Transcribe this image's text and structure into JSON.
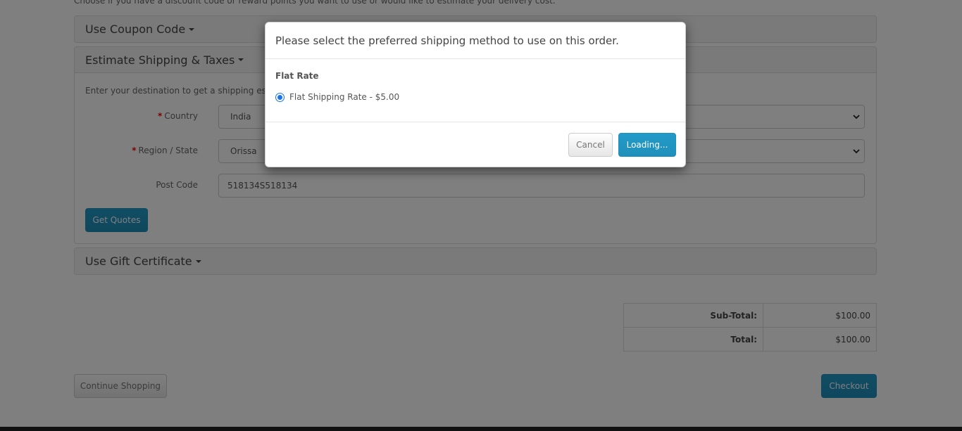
{
  "intro_text": "Choose if you have a discount code or reward points you want to use or would like to estimate your delivery cost.",
  "coupon_panel": {
    "title": "Use Coupon Code"
  },
  "shipping_panel": {
    "title": "Estimate Shipping & Taxes",
    "help_text": "Enter your destination to get a shipping estimate.",
    "country": {
      "label": "Country",
      "required_mark": "*",
      "value": "India"
    },
    "region": {
      "label": "Region / State",
      "required_mark": "*",
      "value": "Orissa"
    },
    "postcode": {
      "label": "Post Code",
      "value": "518134S518134"
    },
    "get_quotes_label": "Get Quotes"
  },
  "gift_panel": {
    "title": "Use Gift Certificate"
  },
  "totals": [
    {
      "label": "Sub-Total:",
      "value": "$100.00"
    },
    {
      "label": "Total:",
      "value": "$100.00"
    }
  ],
  "continue_shopping_label": "Continue Shopping",
  "checkout_label": "Checkout",
  "modal": {
    "title": "Please select the preferred shipping method to use on this order.",
    "method_title": "Flat Rate",
    "option_label": "Flat Shipping Rate - $5.00",
    "option_checked": true,
    "cancel_label": "Cancel",
    "confirm_label": "Loading..."
  },
  "colors": {
    "primary": "#229ac8",
    "required": "#ff0000",
    "radio": "#1a73e8"
  }
}
